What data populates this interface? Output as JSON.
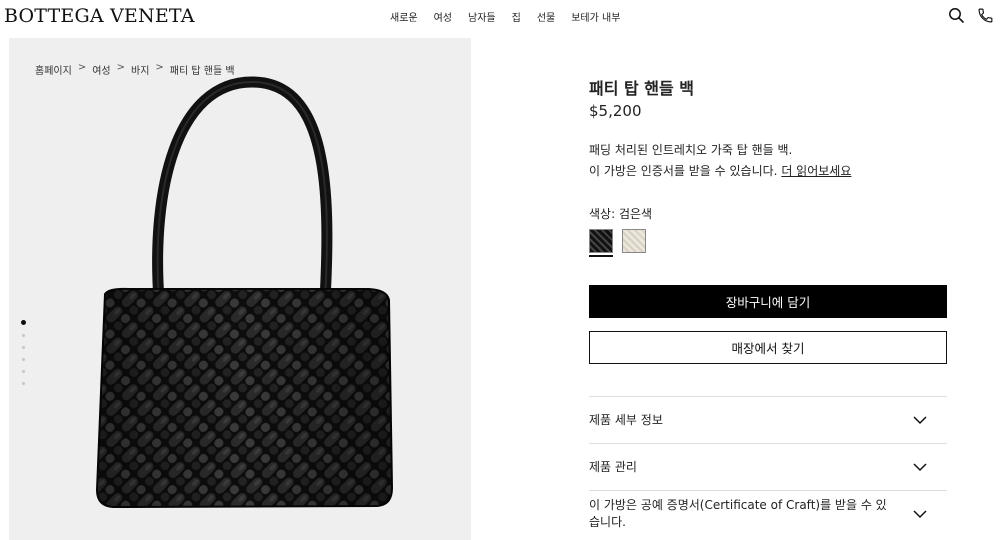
{
  "brand": {
    "logo": "BOTTEGA VENETA"
  },
  "nav": {
    "items": [
      "새로운",
      "여성",
      "남자들",
      "집",
      "선물",
      "보테가 내부"
    ]
  },
  "header_icons": [
    "search-icon",
    "phone-icon"
  ],
  "breadcrumb": {
    "items": [
      "홈페이지",
      "여성",
      "바지",
      "패티 탑 핸들 백"
    ],
    "separator": ">"
  },
  "gallery": {
    "image_count": 6,
    "active_index": 0,
    "background": "#efefef"
  },
  "product": {
    "title": "패티 탑 핸들 백",
    "price": "$5,200",
    "description": "패딩 처리된 인트레치오 가죽 탑 핸들 백.",
    "certificate_text": "이 가방은 인증서를 받을 수 있습니다.",
    "read_more": "더 읽어보세요",
    "color_label": "색상: 검은색",
    "swatches": [
      {
        "name": "검은색",
        "color": "#111111",
        "selected": true
      },
      {
        "name": "크림",
        "color": "#ece7dc",
        "selected": false
      }
    ],
    "add_to_cart": "장바구니에 담기",
    "find_in_store": "매장에서 찾기"
  },
  "accordion": {
    "items": [
      "제품 세부 정보",
      "제품 관리",
      "이 가방은 공예 증명서(Certificate of Craft)를 받을 수 있습니다."
    ]
  },
  "colors": {
    "primary": "#000000",
    "background": "#ffffff",
    "text": "#222222"
  }
}
